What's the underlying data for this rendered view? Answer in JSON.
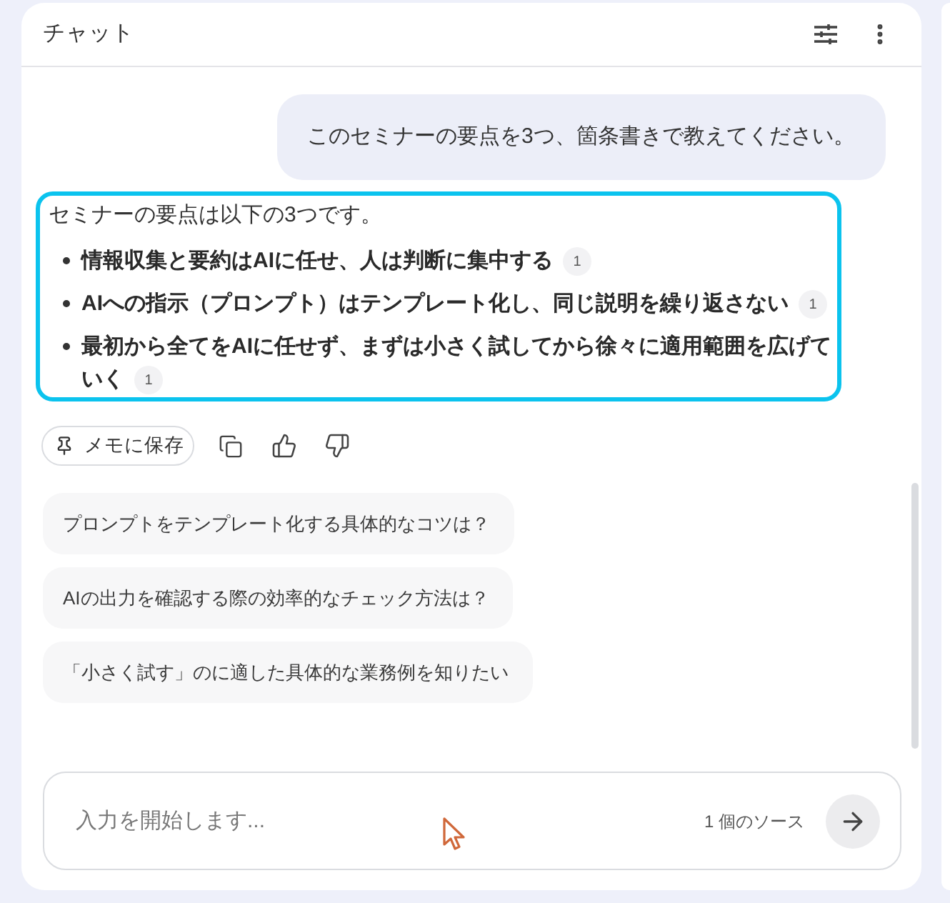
{
  "header": {
    "title": "チャット"
  },
  "user_message": {
    "text": "このセミナーの要点を3つ、箇条書きで教えてください。"
  },
  "response": {
    "selected": true,
    "intro": "セミナーの要点は以下の3つです。",
    "bullets": [
      {
        "text": "情報収集と要約はAIに任せ、人は判断に集中する",
        "citation": "1"
      },
      {
        "text": "AIへの指示（プロンプト）はテンプレート化し、同じ説明を繰り返さない",
        "citation": "1"
      },
      {
        "text": "最初から全てをAIに任せず、まずは小さく試してから徐々に適用範囲を広げていく",
        "citation": "1"
      }
    ]
  },
  "actions": {
    "save_note": "メモに保存"
  },
  "suggestions": [
    "プロンプトをテンプレート化する具体的なコツは？",
    "AIの出力を確認する際の効率的なチェック方法は？",
    "「小さく試す」のに適した具体的な業務例を知りたい"
  ],
  "composer": {
    "placeholder": "入力を開始します...",
    "source_count": "1 個のソース"
  }
}
